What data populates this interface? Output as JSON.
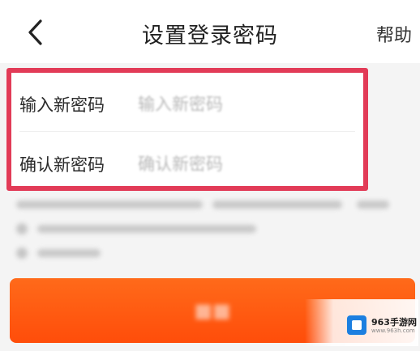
{
  "header": {
    "back_icon": "chevron-left-icon",
    "title": "设置登录密码",
    "help_label": "帮助"
  },
  "form": {
    "new_password": {
      "label": "输入新密码",
      "placeholder": "输入新密码"
    },
    "confirm_password": {
      "label": "确认新密码",
      "placeholder": "确认新密码"
    }
  },
  "highlight": {
    "border_color": "#e23b57"
  },
  "submit": {
    "color": "#ff5a0f"
  },
  "watermark": {
    "text": "963手游网",
    "subtext": "www.963h.com"
  }
}
